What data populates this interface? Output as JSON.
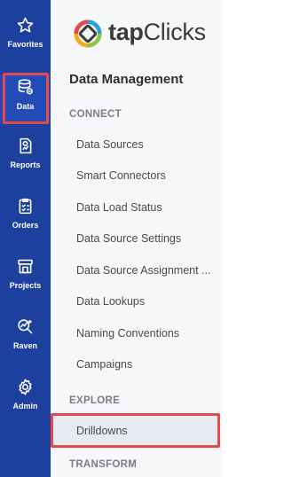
{
  "rail": {
    "items": [
      {
        "label": "Favorites",
        "icon": "star-icon"
      },
      {
        "label": "Data",
        "icon": "database-icon"
      },
      {
        "label": "Reports",
        "icon": "report-icon"
      },
      {
        "label": "Orders",
        "icon": "orders-icon"
      },
      {
        "label": "Projects",
        "icon": "projects-icon"
      },
      {
        "label": "Raven",
        "icon": "raven-icon"
      },
      {
        "label": "Admin",
        "icon": "gear-icon"
      }
    ],
    "active": "Data"
  },
  "brand": {
    "name_bold": "tap",
    "name_light": "Clicks",
    "logo_colors": [
      "#2a9fd8",
      "#8cc63f",
      "#f7a81b",
      "#e5484f"
    ]
  },
  "panel": {
    "title": "Data Management",
    "sections": [
      {
        "heading": "CONNECT",
        "links": [
          "Data Sources",
          "Smart Connectors",
          "Data Load Status",
          "Data Source Settings",
          "Data Source Assignment ...",
          "Data Lookups",
          "Naming Conventions",
          "Campaigns"
        ]
      },
      {
        "heading": "EXPLORE",
        "links": [
          "Drilldowns"
        ]
      },
      {
        "heading": "TRANSFORM",
        "links": []
      }
    ]
  },
  "colors": {
    "rail_bg": "#1d3f9e",
    "highlight": "#e5484f",
    "panel_bg": "#f6f7f9"
  }
}
